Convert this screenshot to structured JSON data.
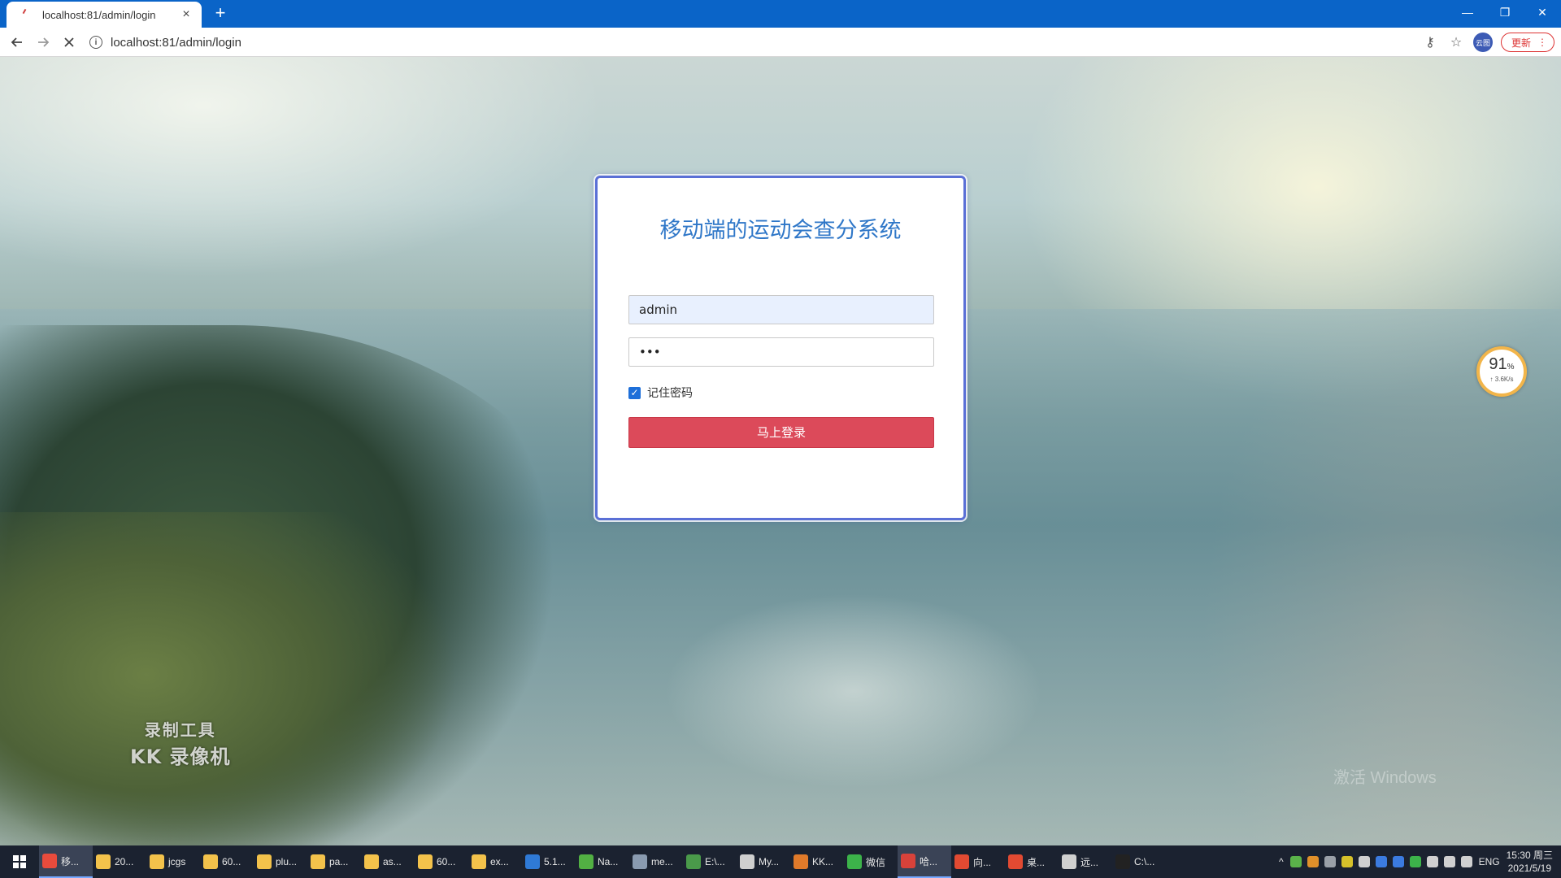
{
  "browser": {
    "tab_title": "localhost:81/admin/login",
    "tab_close": "×",
    "new_tab": "+",
    "url": "localhost:81/admin/login",
    "profile_label": "云图",
    "update_label": "更新",
    "window_controls": [
      "—",
      "❐",
      "✕"
    ]
  },
  "login": {
    "title": "移动端的运动会查分系统",
    "username_value": "admin",
    "password_value": "•••",
    "remember_label": "记住密码",
    "remember_checked": true,
    "submit_label": "马上登录"
  },
  "overlay": {
    "watermark_line1": "录制工具",
    "watermark_line2": "KK 录像机",
    "windows_watermark": "激活 Windows",
    "speed_percent": "91",
    "speed_unit": "%",
    "speed_rate": "↑ 3.6K/s"
  },
  "taskbar": {
    "items": [
      {
        "label": "移...",
        "icon": "chrome-icon",
        "color": "#e94b3c",
        "active": true
      },
      {
        "label": "20...",
        "icon": "folder-icon",
        "color": "#f3c24b"
      },
      {
        "label": "jcgs",
        "icon": "folder-icon",
        "color": "#f3c24b"
      },
      {
        "label": "60...",
        "icon": "folder-icon",
        "color": "#f3c24b"
      },
      {
        "label": "plu...",
        "icon": "folder-icon",
        "color": "#f3c24b"
      },
      {
        "label": "pa...",
        "icon": "folder-icon",
        "color": "#f3c24b"
      },
      {
        "label": "as...",
        "icon": "folder-icon",
        "color": "#f3c24b"
      },
      {
        "label": "60...",
        "icon": "folder-icon",
        "color": "#f3c24b"
      },
      {
        "label": "ex...",
        "icon": "folder-icon",
        "color": "#f3c24b"
      },
      {
        "label": "5.1...",
        "icon": "vscode-icon",
        "color": "#2f7ad6"
      },
      {
        "label": "Na...",
        "icon": "navicat-icon",
        "color": "#52b043"
      },
      {
        "label": "me...",
        "icon": "app-icon",
        "color": "#8a9bb0"
      },
      {
        "label": "E:\\...",
        "icon": "editor-icon",
        "color": "#4a9a4a"
      },
      {
        "label": "My...",
        "icon": "feather-icon",
        "color": "#cfcfcf"
      },
      {
        "label": "KK...",
        "icon": "kk-recorder-icon",
        "color": "#e07a2a"
      },
      {
        "label": "微信",
        "icon": "wechat-icon",
        "color": "#3cb34a"
      },
      {
        "label": "哈...",
        "icon": "app-icon",
        "color": "#d8423a",
        "active": true
      },
      {
        "label": "向...",
        "icon": "app-icon",
        "color": "#e24a32"
      },
      {
        "label": "桌...",
        "icon": "app-icon",
        "color": "#e24a32"
      },
      {
        "label": "远...",
        "icon": "chat-icon",
        "color": "#d0d0d0"
      },
      {
        "label": "C:\\...",
        "icon": "terminal-icon",
        "color": "#222222"
      }
    ],
    "tray_icons": [
      "#5ab34a",
      "#e0902a",
      "#9aa0a8",
      "#d6c12a",
      "#d0d0d0",
      "#3b7be0",
      "#3b7be0",
      "#3cb34a",
      "#d0d0d0",
      "#d0d0d0",
      "#d0d0d0"
    ],
    "lang": "ENG",
    "time": "15:30 周三",
    "date": "2021/5/19"
  }
}
